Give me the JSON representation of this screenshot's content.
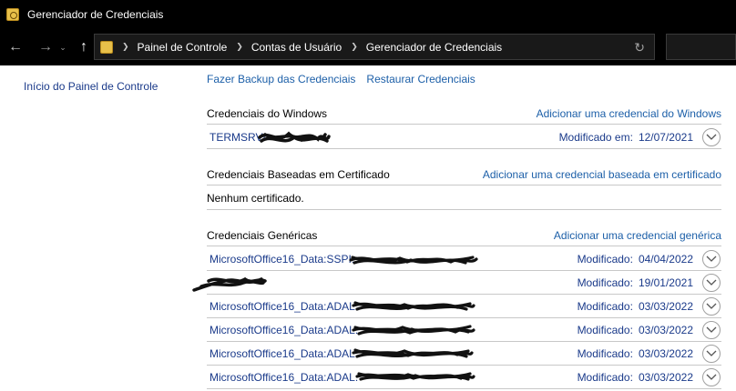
{
  "window": {
    "title": "Gerenciador de Credenciais",
    "icon": "credential-manager-icon"
  },
  "nav": {
    "back_icon": "arrow-left-icon",
    "forward_icon": "arrow-right-icon",
    "recent_icon": "chevron-down-icon",
    "up_icon": "arrow-up-icon",
    "breadcrumbs": [
      "Painel de Controle",
      "Contas de Usuário",
      "Gerenciador de Credenciais"
    ],
    "refresh_icon": "refresh-icon"
  },
  "sidebar": {
    "home_link": "Início do Painel de Controle"
  },
  "actions": {
    "backup": "Fazer Backup das Credenciais",
    "restore": "Restaurar Credenciais"
  },
  "windows_section": {
    "title": "Credenciais do Windows",
    "add_link": "Adicionar uma credencial do Windows",
    "items": [
      {
        "name": "TERMSRV/",
        "modified_label": "Modificado em:",
        "date": "12/07/2021"
      }
    ]
  },
  "cert_section": {
    "title": "Credenciais Baseadas em Certificado",
    "add_link": "Adicionar uma credencial baseada em certificado",
    "empty_text": "Nenhum certificado."
  },
  "generic_section": {
    "title": "Credenciais Genéricas",
    "add_link": "Adicionar uma credencial genérica",
    "items": [
      {
        "name": "MicrosoftOffice16_Data:SSPI:",
        "modified_label": "Modificado:",
        "date": "04/04/2022"
      },
      {
        "name": "",
        "modified_label": "Modificado:",
        "date": "19/01/2021"
      },
      {
        "name": "MicrosoftOffice16_Data:ADAL:",
        "modified_label": "Modificado:",
        "date": "03/03/2022"
      },
      {
        "name": "MicrosoftOffice16_Data:ADAL:",
        "modified_label": "Modificado:",
        "date": "03/03/2022"
      },
      {
        "name": "MicrosoftOffice16_Data:ADAL:",
        "modified_label": "Modificado:",
        "date": "03/03/2022"
      },
      {
        "name": "MicrosoftOffice16_Data:ADAL:",
        "modified_label": "Modificado:",
        "date": "03/03/2022"
      }
    ]
  },
  "colors": {
    "link": "#1c5fa8",
    "item_text": "#1a3a8a",
    "titlebar": "#000000",
    "divider": "#c8c8c8"
  }
}
